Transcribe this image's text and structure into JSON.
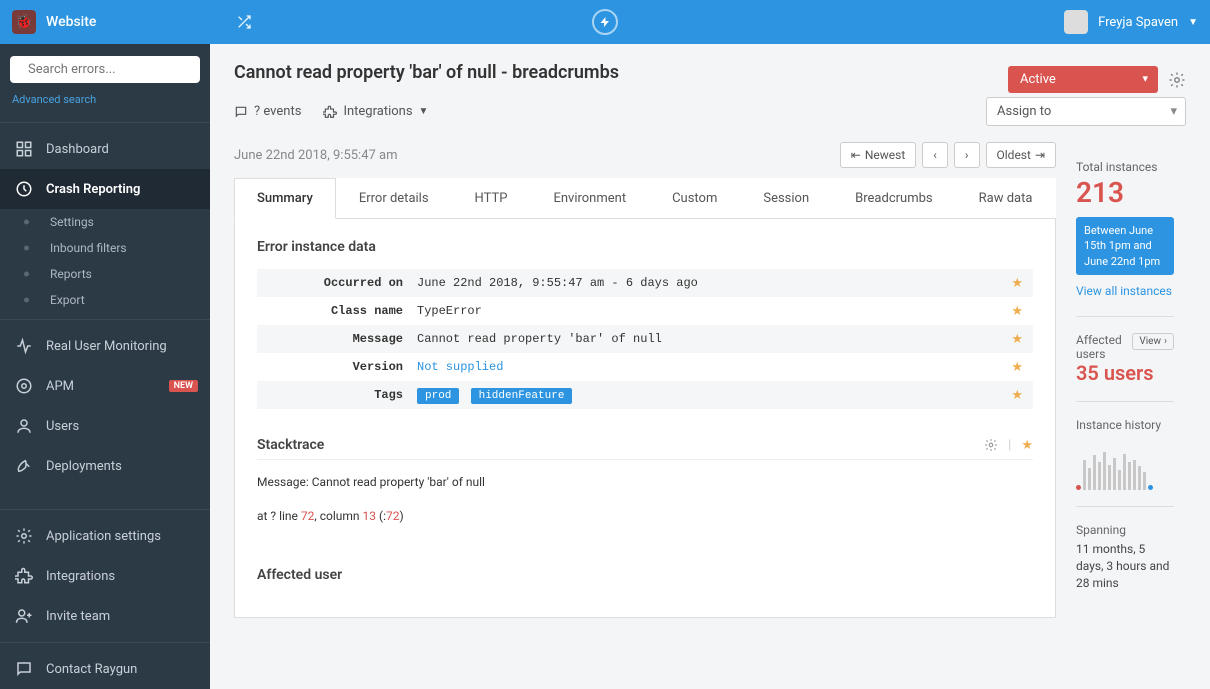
{
  "topbar": {
    "app_name": "Website",
    "user_name": "Freyja Spaven"
  },
  "search": {
    "placeholder": "Search errors...",
    "advanced_label": "Advanced search"
  },
  "nav": {
    "dashboard": "Dashboard",
    "crash_reporting": "Crash Reporting",
    "settings": "Settings",
    "inbound_filters": "Inbound filters",
    "reports": "Reports",
    "export": "Export",
    "rum": "Real User Monitoring",
    "apm": "APM",
    "apm_badge": "NEW",
    "users": "Users",
    "deployments": "Deployments",
    "app_settings": "Application settings",
    "integrations": "Integrations",
    "invite": "Invite team",
    "contact": "Contact Raygun"
  },
  "header": {
    "title": "Cannot read property 'bar' of null - breadcrumbs",
    "status": "Active",
    "events_label": "? events",
    "integrations_label": "Integrations",
    "assign_label": "Assign to"
  },
  "timestamp": "June 22nd 2018, 9:55:47 am",
  "pager": {
    "newest": "Newest",
    "oldest": "Oldest"
  },
  "tabs": {
    "summary": "Summary",
    "error_details": "Error details",
    "http": "HTTP",
    "environment": "Environment",
    "custom": "Custom",
    "session": "Session",
    "breadcrumbs": "Breadcrumbs",
    "raw": "Raw data"
  },
  "instance": {
    "section_title": "Error instance data",
    "occurred_label": "Occurred on",
    "occurred_value": "June 22nd 2018, 9:55:47 am - 6 days ago",
    "class_label": "Class name",
    "class_value": "TypeError",
    "message_label": "Message",
    "message_value": "Cannot read property 'bar' of null",
    "version_label": "Version",
    "version_value": "Not supplied",
    "tags_label": "Tags",
    "tag1": "prod",
    "tag2": "hiddenFeature"
  },
  "stacktrace": {
    "title": "Stacktrace",
    "message_prefix": "Message: ",
    "message": "Cannot read property 'bar' of null",
    "at_prefix": "at ? line ",
    "line": "72",
    "col_prefix": ", column ",
    "col": "13",
    "paren_prefix": " (:",
    "paren_val": "72",
    "paren_suffix": ")"
  },
  "affected": {
    "title": "Affected user"
  },
  "right": {
    "total_label": "Total instances",
    "total_value": "213",
    "range": "Between June 15th 1pm and June 22nd 1pm",
    "view_all": "View all instances",
    "affected_label": "Affected users",
    "view_btn": "View",
    "users_value": "35 users",
    "history_label": "Instance history",
    "spanning_label": "Spanning",
    "spanning_value": "11 months, 5 days, 3 hours and 28 mins"
  }
}
